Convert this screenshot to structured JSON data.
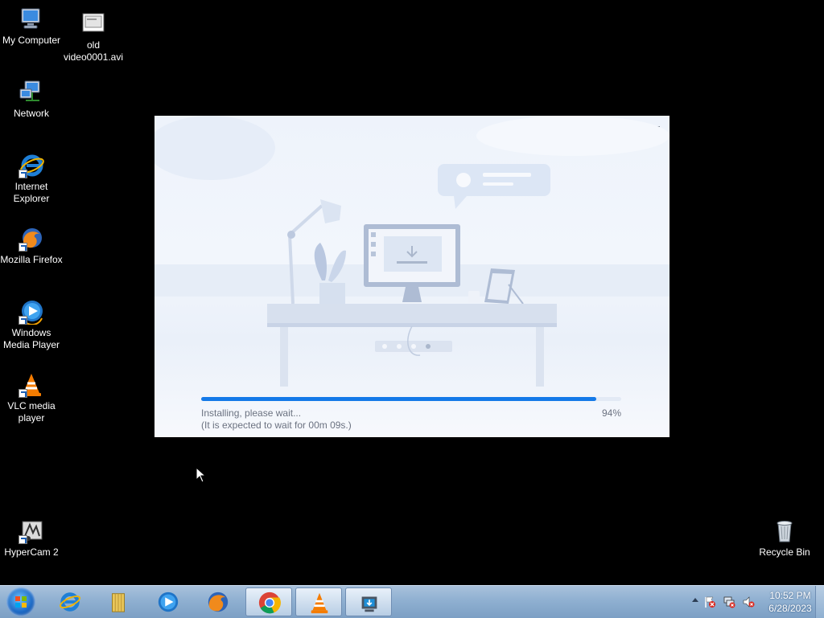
{
  "desktop": {
    "icons": [
      {
        "label": "My Computer"
      },
      {
        "label": "old video0001.avi"
      },
      {
        "label": "Network"
      },
      {
        "label": "Internet Explorer"
      },
      {
        "label": "Mozilla Firefox"
      },
      {
        "label": "Windows Media Player"
      },
      {
        "label": "VLC media player"
      },
      {
        "label": "HyperCam 2"
      },
      {
        "label": "Recycle Bin"
      }
    ]
  },
  "installer": {
    "minimize_glyph": "—",
    "status_line1": "Installing, please wait...",
    "status_line2": "(It is expected to wait for 00m 09s.)",
    "progress_percent": 94,
    "progress_label": "94%",
    "accent_color": "#1479e8"
  },
  "taskbar": {
    "pinned": [
      {
        "name": "Internet Explorer",
        "icon": "ie-icon"
      },
      {
        "name": "Windows Explorer",
        "icon": "folder-icon"
      },
      {
        "name": "Windows Media Player",
        "icon": "media-player-icon"
      },
      {
        "name": "Mozilla Firefox",
        "icon": "firefox-icon"
      },
      {
        "name": "Google Chrome",
        "icon": "chrome-icon"
      },
      {
        "name": "VLC media player",
        "icon": "vlc-icon"
      },
      {
        "name": "Installer",
        "icon": "installer-icon"
      }
    ],
    "clock": {
      "time": "10:52 PM",
      "date": "6/28/2023"
    }
  }
}
